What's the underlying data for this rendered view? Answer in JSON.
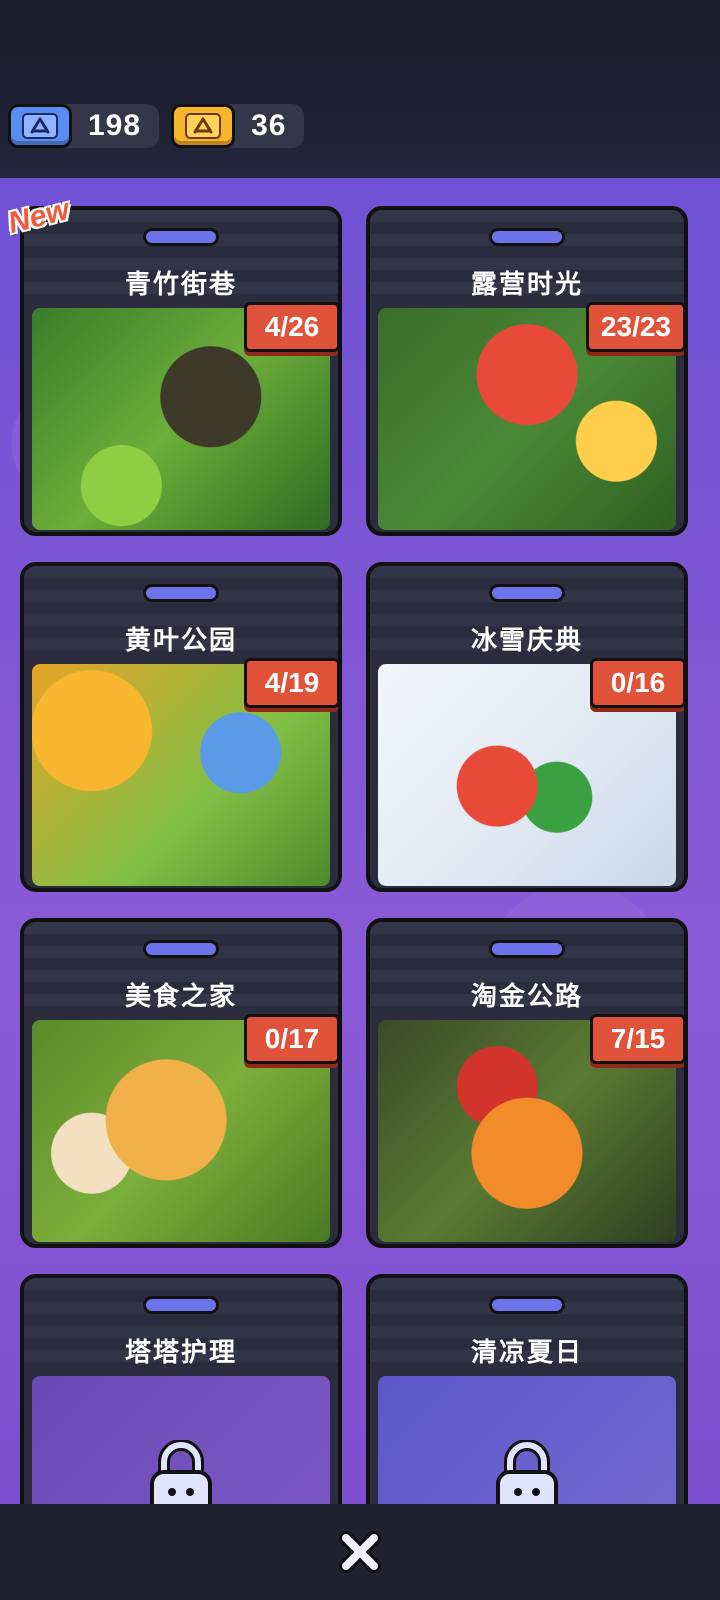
{
  "currencies": [
    {
      "icon": "blue-ticket-icon",
      "value": "198",
      "color": "#5b8cf2"
    },
    {
      "icon": "gold-ticket-icon",
      "value": "36",
      "color": "#f7b52c"
    }
  ],
  "new_label": "New",
  "cards": [
    {
      "title": "青竹街巷",
      "progress": "4/26",
      "locked": false
    },
    {
      "title": "露营时光",
      "progress": "23/23",
      "locked": false
    },
    {
      "title": "黄叶公园",
      "progress": "4/19",
      "locked": false
    },
    {
      "title": "冰雪庆典",
      "progress": "0/16",
      "locked": false
    },
    {
      "title": "美食之家",
      "progress": "0/17",
      "locked": false
    },
    {
      "title": "淘金公路",
      "progress": "7/15",
      "locked": false
    },
    {
      "title": "塔塔护理",
      "progress": "",
      "locked": true
    },
    {
      "title": "清凉夏日",
      "progress": "",
      "locked": true
    }
  ],
  "colors": {
    "accent_badge": "#e0533a",
    "background": "#7a5ad6",
    "card": "#2b2d3e"
  }
}
